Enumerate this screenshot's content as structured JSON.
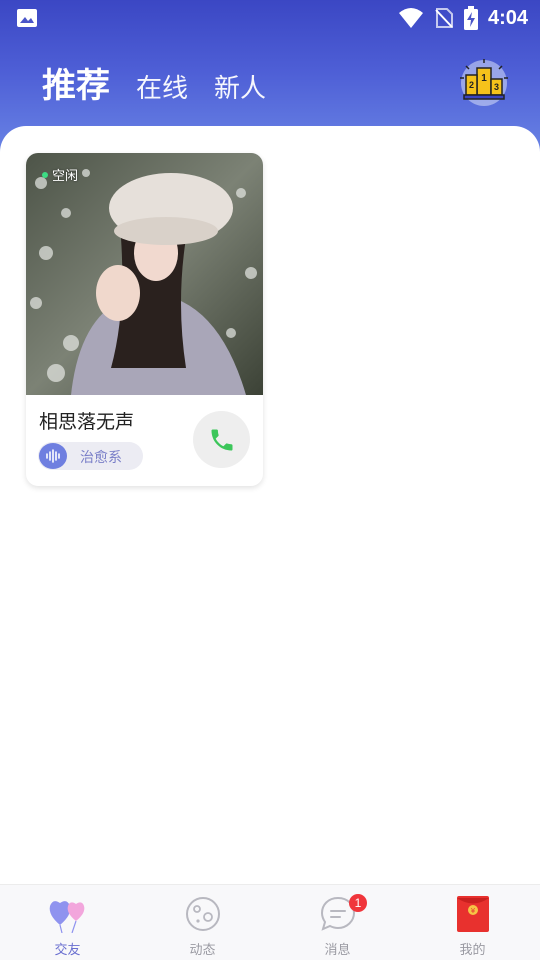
{
  "status_bar": {
    "time": "4:04",
    "icons": [
      "gallery-icon",
      "wifi-icon",
      "no-sim-icon",
      "battery-charging-icon"
    ]
  },
  "header": {
    "tabs": [
      {
        "label": "推荐",
        "active": true
      },
      {
        "label": "在线",
        "active": false
      },
      {
        "label": "新人",
        "active": false
      }
    ],
    "ranking_icon": "podium-icon"
  },
  "cards": [
    {
      "status": "空闲",
      "name": "相思落无声",
      "tag": "治愈系",
      "call_icon": "phone-icon"
    }
  ],
  "bottom_nav": {
    "items": [
      {
        "label": "交友",
        "icon": "balloon-hearts-icon",
        "active": true
      },
      {
        "label": "动态",
        "icon": "planet-icon",
        "active": false
      },
      {
        "label": "消息",
        "icon": "chat-bubble-icon",
        "active": false,
        "badge": "1"
      },
      {
        "label": "我的",
        "icon": "red-envelope-icon",
        "active": false
      }
    ]
  },
  "colors": {
    "header_top": "#3b47c4",
    "header_bottom": "#6b86e6",
    "accent": "#6a6fd0",
    "online_dot": "#3ddc84",
    "badge": "#f0353b",
    "call_green": "#3cc65a"
  }
}
